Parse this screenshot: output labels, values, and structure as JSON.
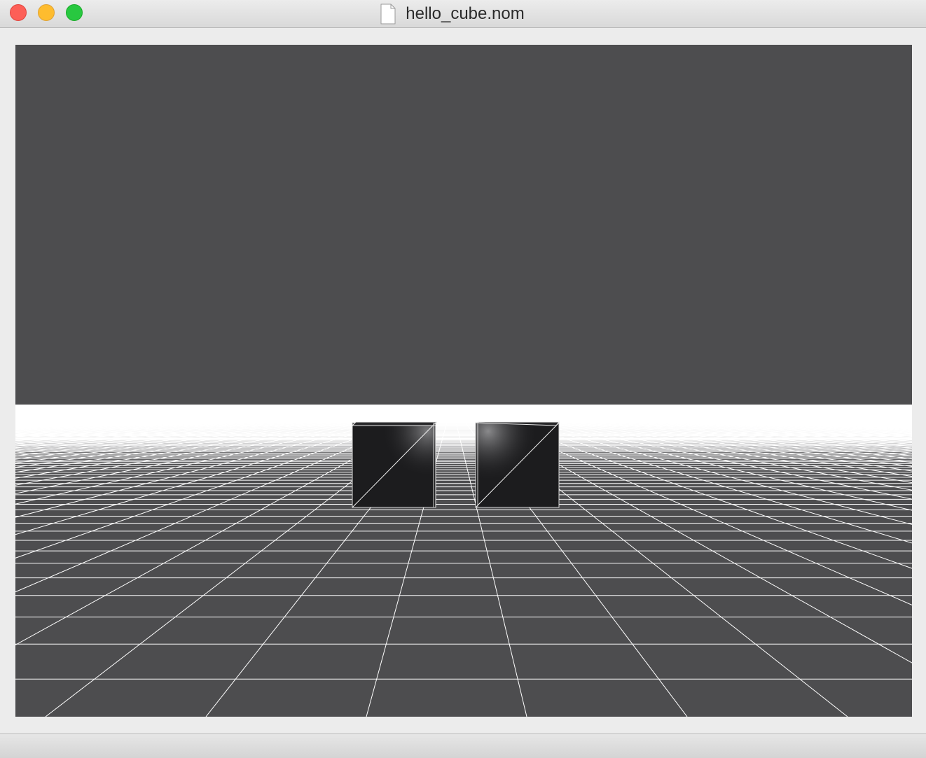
{
  "window": {
    "title": "hello_cube.nom",
    "document_icon": "document-icon",
    "controls": [
      "close-button",
      "minimize-button",
      "zoom-button"
    ]
  },
  "scene": {
    "background_color": "#4d4d4f",
    "grid_line_color": "#ffffff",
    "cube_color": "#1c1c1e",
    "cube_count": 2
  }
}
